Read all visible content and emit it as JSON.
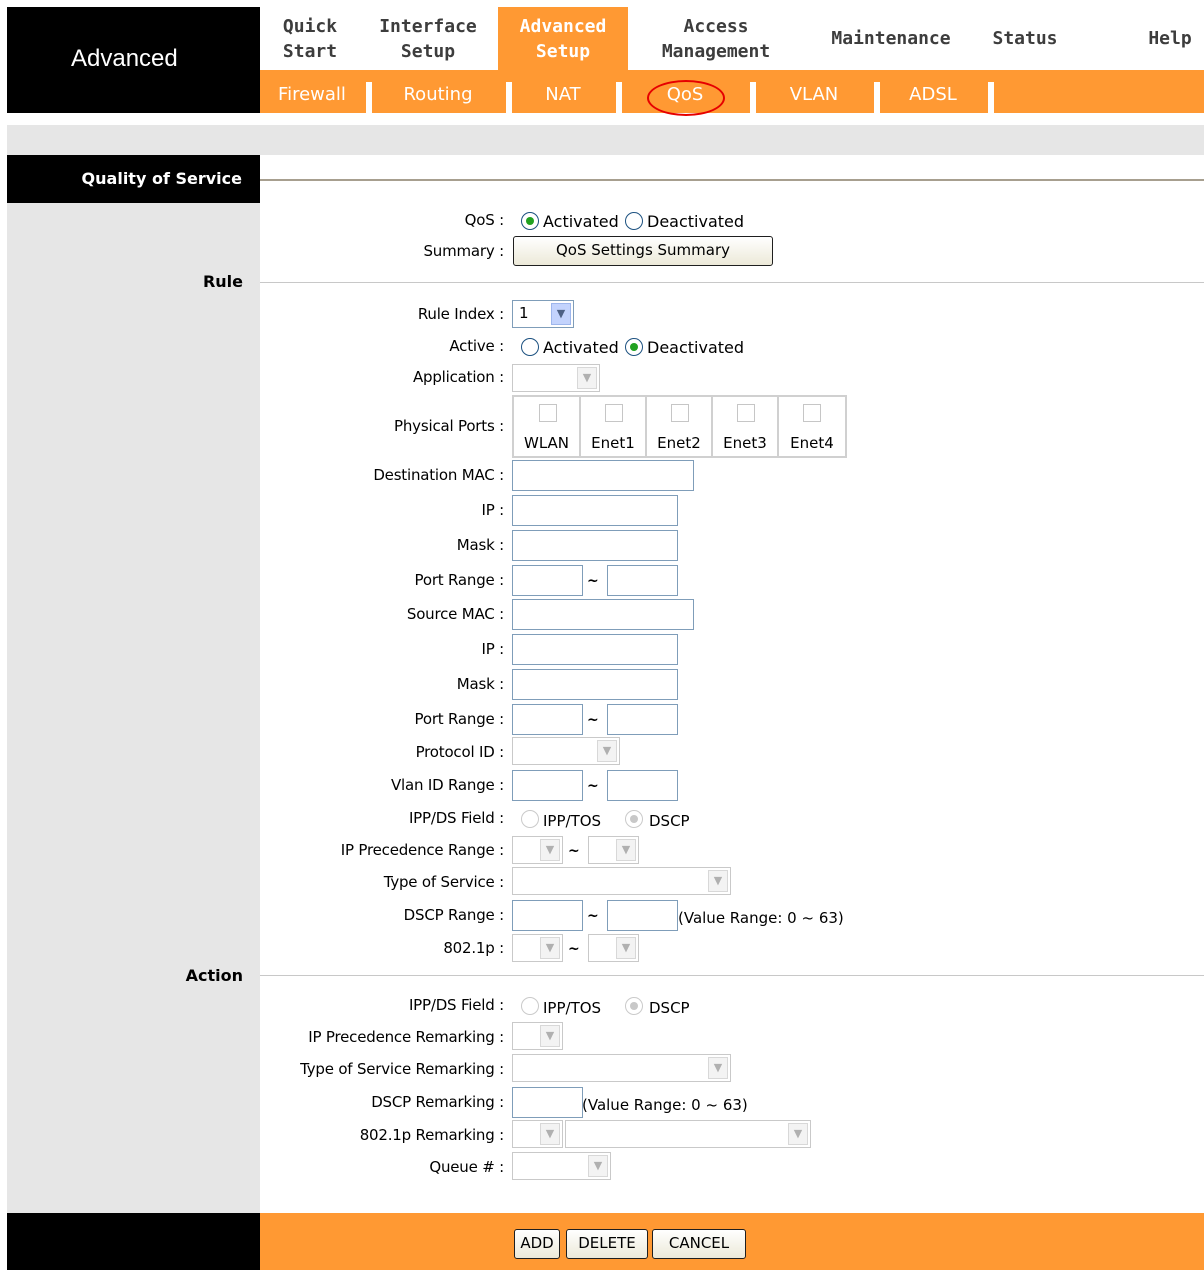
{
  "header": {
    "brand": "Advanced",
    "top_nav": [
      {
        "line1": "Quick",
        "line2": "Start"
      },
      {
        "line1": "Interface",
        "line2": "Setup"
      },
      {
        "line1": "Advanced",
        "line2": "Setup",
        "active": true
      },
      {
        "line1": "Access",
        "line2": "Management"
      },
      {
        "line1": "Maintenance",
        "line2": ""
      },
      {
        "line1": "Status",
        "line2": ""
      },
      {
        "line1": "Help",
        "line2": ""
      }
    ],
    "sub_nav": [
      "Firewall",
      "Routing",
      "NAT",
      "QoS",
      "VLAN",
      "ADSL"
    ],
    "highlighted_sub_nav": "QoS"
  },
  "section": {
    "title": "Quality of Service",
    "rule_label": "Rule",
    "action_label": "Action"
  },
  "qos": {
    "label": "QoS :",
    "activated": "Activated",
    "deactivated": "Deactivated",
    "selected": "Activated"
  },
  "summary": {
    "label": "Summary :",
    "button": "QoS Settings Summary"
  },
  "rule": {
    "rule_index_label": "Rule Index :",
    "rule_index_value": "1",
    "active_label": "Active :",
    "active_activated": "Activated",
    "active_deactivated": "Deactivated",
    "active_selected": "Deactivated",
    "application_label": "Application :",
    "physical_ports_label": "Physical Ports :",
    "ports": [
      "WLAN",
      "Enet1",
      "Enet2",
      "Enet3",
      "Enet4"
    ],
    "dest_mac_label": "Destination MAC :",
    "ip_label": "IP :",
    "mask_label": "Mask :",
    "port_range_label": "Port Range :",
    "source_mac_label": "Source MAC :",
    "protocol_id_label": "Protocol ID :",
    "vlan_range_label": "Vlan ID Range :",
    "ippds_label": "IPP/DS Field :",
    "ipp_tos": "IPP/TOS",
    "dscp": "DSCP",
    "ip_precedence_range_label": "IP Precedence Range :",
    "type_of_service_label": "Type of Service :",
    "dscp_range_label": "DSCP Range :",
    "dscp_range_hint": "(Value Range: 0 ~ 63)",
    "dot1p_label": "802.1p :",
    "tilde": "~"
  },
  "action": {
    "ippds_label": "IPP/DS Field :",
    "ipp_tos": "IPP/TOS",
    "dscp": "DSCP",
    "ip_precedence_remarking_label": "IP Precedence Remarking :",
    "tos_remarking_label": "Type of Service Remarking :",
    "dscp_remarking_label": "DSCP Remarking :",
    "dscp_remarking_hint": "(Value Range: 0 ~ 63)",
    "dot1p_remarking_label": "802.1p Remarking :",
    "queue_label": "Queue # :"
  },
  "buttons": {
    "add": "ADD",
    "delete": "DELETE",
    "cancel": "CANCEL"
  },
  "colors": {
    "accent_orange": "#ff9933",
    "header_black": "#000000",
    "panel_grey": "#e6e6e6",
    "highlight_circle": "#e60000"
  }
}
